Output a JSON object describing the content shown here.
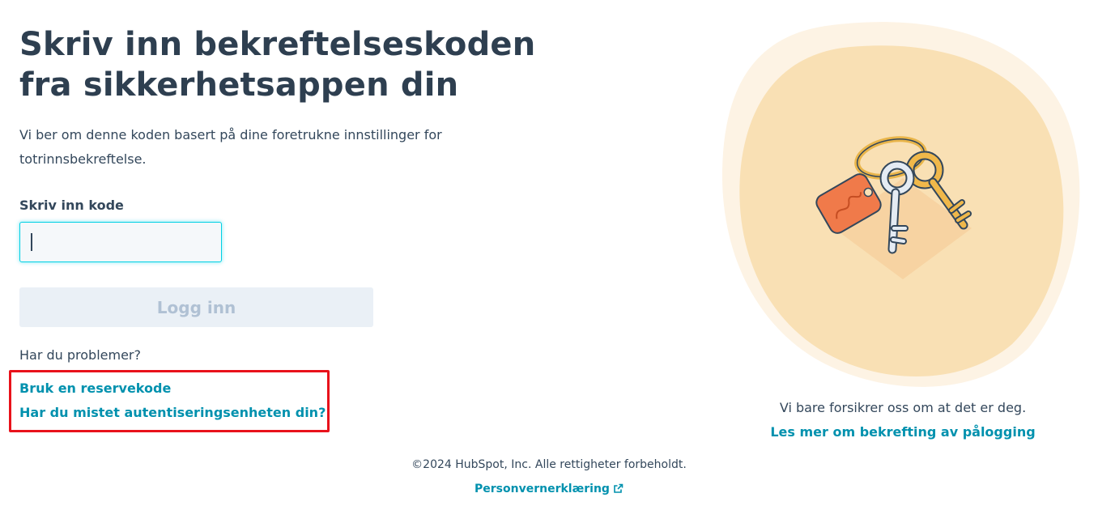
{
  "page": {
    "title": "Skriv inn bekreftelseskoden fra sikkerhetsappen din",
    "description": "Vi ber om denne koden basert på dine foretrukne innstillinger for totrinnsbekreftelse."
  },
  "form": {
    "code_label": "Skriv inn kode",
    "code_value": "",
    "login_button": "Logg inn"
  },
  "help": {
    "problems_text": "Har du problemer?",
    "backup_code_link": "Bruk en reservekode",
    "lost_device_link": "Har du mistet autentiseringsenheten din?"
  },
  "side": {
    "reassure_text": "Vi bare forsikrer oss om at det er deg.",
    "learn_more_link": "Les mer om bekrefting av pålogging",
    "illustration_icon": "keys-icon"
  },
  "footer": {
    "copyright": "©2024 HubSpot, Inc. Alle rettigheter forbeholdt.",
    "privacy_link": "Personvernerklæring",
    "privacy_icon": "external-link-icon"
  },
  "colors": {
    "link": "#0091ae",
    "heading": "#2e3f50",
    "highlight_box": "#e8121b",
    "input_focus": "#00d0e4",
    "illustration_bg": "#f9e0b4"
  }
}
